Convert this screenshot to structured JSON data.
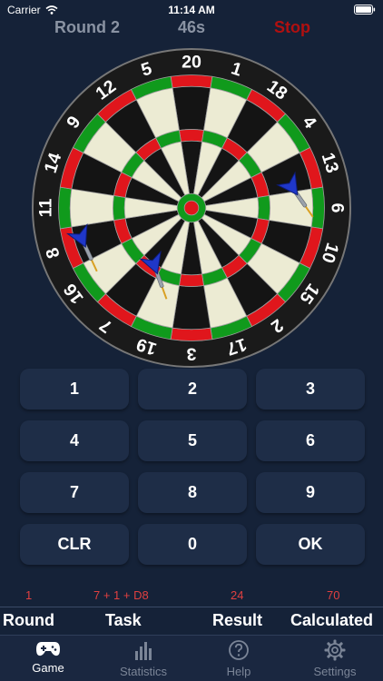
{
  "status_bar": {
    "carrier": "Carrier",
    "time": "11:14 AM"
  },
  "header": {
    "round": "Round 2",
    "timer": "46s",
    "stop": "Stop"
  },
  "board": {
    "numbers": [
      "20",
      "1",
      "18",
      "4",
      "13",
      "6",
      "10",
      "15",
      "2",
      "17",
      "3",
      "19",
      "7",
      "16",
      "8",
      "11",
      "14",
      "9",
      "12",
      "5"
    ],
    "colors": {
      "black": "#141414",
      "cream": "#ecebd3",
      "red": "#e0161c",
      "green": "#109a1c",
      "rim": "#1a1a1a",
      "wire": "#a0a0a0"
    }
  },
  "keypad": {
    "keys": [
      "1",
      "2",
      "3",
      "4",
      "5",
      "6",
      "7",
      "8",
      "9",
      "CLR",
      "0",
      "OK"
    ]
  },
  "history": {
    "round": "1",
    "task": "7 + 1 + D8",
    "result": "24",
    "calculated": "70"
  },
  "columns": {
    "round": "Round",
    "task": "Task",
    "result": "Result",
    "calculated": "Calculated"
  },
  "tabs": [
    {
      "label": "Game",
      "icon": "gamepad-icon",
      "active": true
    },
    {
      "label": "Statistics",
      "icon": "bar-chart-icon",
      "active": false
    },
    {
      "label": "Help",
      "icon": "help-icon",
      "active": false
    },
    {
      "label": "Settings",
      "icon": "gear-icon",
      "active": false
    }
  ],
  "colors": {
    "background": "#152238",
    "key": "#1e2d47",
    "stop": "#b01010",
    "history": "#e04040",
    "muted": "#8a93a3"
  }
}
